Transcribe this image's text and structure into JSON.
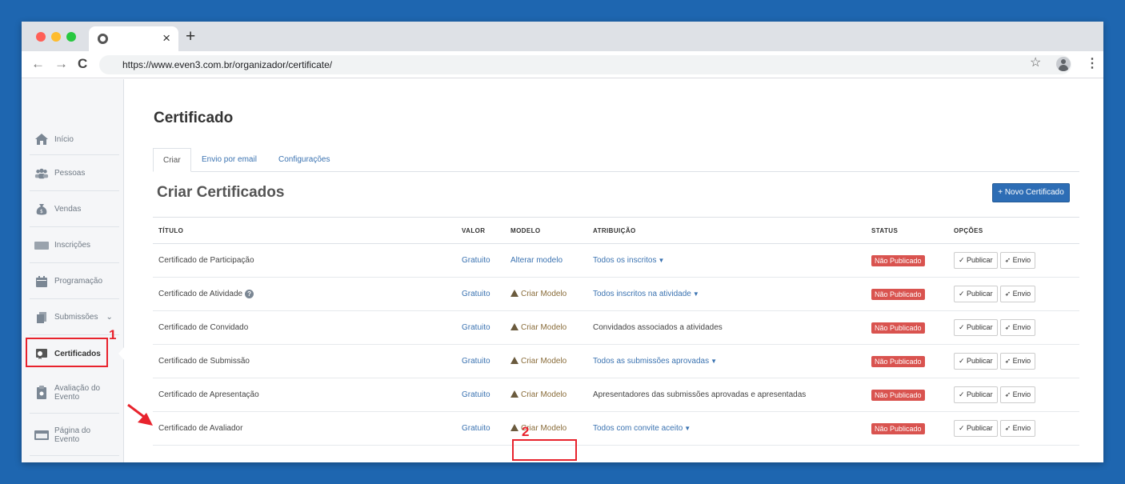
{
  "browser": {
    "url": "https://www.even3.com.br/organizador/certificate/",
    "new_tab": "+",
    "tab_close": "×",
    "back": "←",
    "forward": "→",
    "reload": "C",
    "star": "☆",
    "menu": "⋮"
  },
  "sidebar": {
    "items": [
      {
        "label": "Início",
        "icon": "home-icon"
      },
      {
        "label": "Pessoas",
        "icon": "people-icon"
      },
      {
        "label": "Vendas",
        "icon": "money-bag-icon"
      },
      {
        "label": "Inscrições",
        "icon": "ticket-icon"
      },
      {
        "label": "Programação",
        "icon": "calendar-icon"
      },
      {
        "label": "Submissões",
        "icon": "documents-icon",
        "chevron": "⌄"
      },
      {
        "label": "Certificados",
        "icon": "certificate-icon"
      },
      {
        "label": "Avaliação do Evento",
        "icon": "clipboard-icon"
      },
      {
        "label": "Página do Evento",
        "icon": "webpage-icon"
      }
    ],
    "marker_number": "1"
  },
  "page": {
    "title": "Certificado",
    "tabs": [
      "Criar",
      "Envio por email",
      "Configurações"
    ],
    "active_tab": "Criar",
    "section_title": "Criar Certificados",
    "new_button": "+ Novo Certificado"
  },
  "table": {
    "headers": [
      "TÍTULO",
      "VALOR",
      "MODELO",
      "ATRIBUIÇÃO",
      "STATUS",
      "OPÇÕES"
    ],
    "rows": [
      {
        "title": "Certificado de Participação",
        "valor": "Gratuito",
        "modelo": "Alterar modelo",
        "modelo_warn": false,
        "atribuicao": "Todos os inscritos",
        "atribuicao_link": true,
        "status": "Não Publicado",
        "publicar": "Publicar",
        "envio": "Envio"
      },
      {
        "title": "Certificado de Atividade",
        "help": true,
        "valor": "Gratuito",
        "modelo": "Criar Modelo",
        "modelo_warn": true,
        "atribuicao": "Todos inscritos na atividade",
        "atribuicao_link": true,
        "status": "Não Publicado",
        "publicar": "Publicar",
        "envio": "Envio"
      },
      {
        "title": "Certificado de Convidado",
        "valor": "Gratuito",
        "modelo": "Criar Modelo",
        "modelo_warn": true,
        "atribuicao": "Convidados associados a atividades",
        "atribuicao_link": false,
        "status": "Não Publicado",
        "publicar": "Publicar",
        "envio": "Envio"
      },
      {
        "title": "Certificado de Submissão",
        "valor": "Gratuito",
        "modelo": "Criar Modelo",
        "modelo_warn": true,
        "atribuicao": "Todos as submissões aprovadas",
        "atribuicao_link": true,
        "status": "Não Publicado",
        "publicar": "Publicar",
        "envio": "Envio"
      },
      {
        "title": "Certificado de Apresentação",
        "valor": "Gratuito",
        "modelo": "Criar Modelo",
        "modelo_warn": true,
        "atribuicao": "Apresentadores das submissões aprovadas e apresentadas",
        "atribuicao_link": false,
        "status": "Não Publicado",
        "publicar": "Publicar",
        "envio": "Envio"
      },
      {
        "title": "Certificado de Avaliador",
        "valor": "Gratuito",
        "modelo": "Criar Modelo",
        "modelo_warn": true,
        "atribuicao": "Todos com convite aceito",
        "atribuicao_link": true,
        "status": "Não Publicado",
        "publicar": "Publicar",
        "envio": "Envio"
      }
    ],
    "marker_number": "2"
  },
  "colors": {
    "background": "#1e66b0",
    "accent": "#2d6db5",
    "link": "#3b73b1",
    "badge": "#d9534f",
    "annotation": "#e8232d"
  }
}
